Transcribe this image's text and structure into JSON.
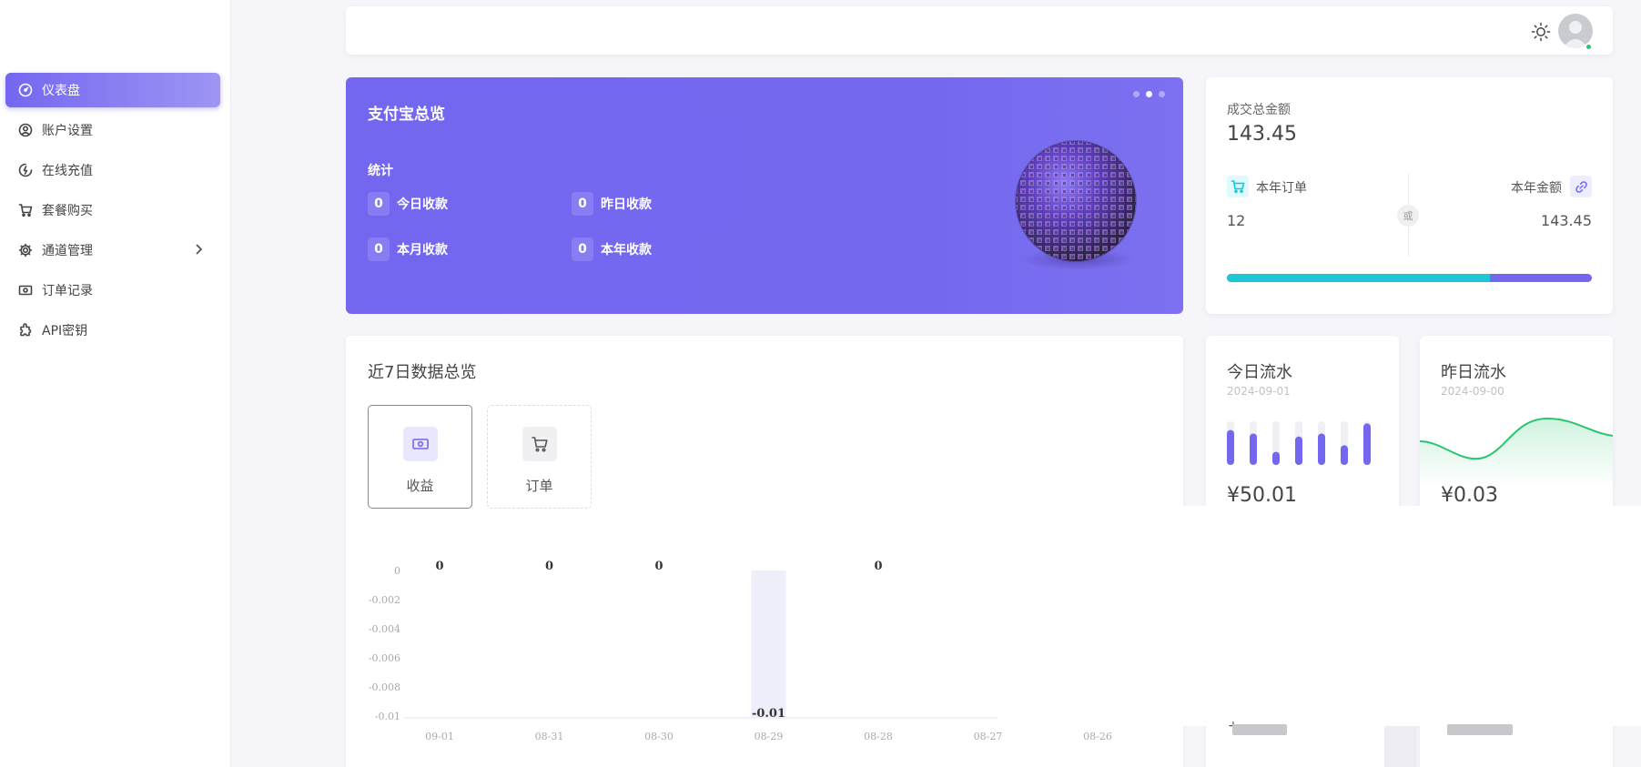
{
  "sidebar": {
    "items": [
      {
        "label": "仪表盘",
        "icon": "gauge-icon",
        "active": true
      },
      {
        "label": "账户设置",
        "icon": "user-circle-icon"
      },
      {
        "label": "在线充值",
        "icon": "recharge-icon"
      },
      {
        "label": "套餐购买",
        "icon": "cart-icon"
      },
      {
        "label": "通道管理",
        "icon": "gear-icon",
        "has_submenu": true
      },
      {
        "label": "订单记录",
        "icon": "banknote-icon"
      },
      {
        "label": "API密钥",
        "icon": "puzzle-icon"
      }
    ]
  },
  "header": {
    "theme_icon": "sun-icon",
    "avatar": "avatar",
    "online_status_color": "#28c76f"
  },
  "alipay_card": {
    "title": "支付宝总览",
    "section_label": "统计",
    "stats": [
      {
        "value": "0",
        "label": "今日收款"
      },
      {
        "value": "0",
        "label": "昨日收款"
      },
      {
        "value": "0",
        "label": "本月收款"
      },
      {
        "value": "0",
        "label": "本年收款"
      }
    ],
    "carousel_dots": 3,
    "carousel_active": 1,
    "background_color": "#7367f0"
  },
  "total_card": {
    "label": "成交总金额",
    "value": "143.45",
    "orders_label": "本年订单",
    "orders_value": "12",
    "amount_label": "本年金额",
    "amount_value": "143.45",
    "divider_text": "或",
    "progress_fraction": 0.72,
    "progress_colors": {
      "fill": "#1ec6d6",
      "track": "#7367f0"
    }
  },
  "week_card": {
    "title": "近7日数据总览",
    "tabs": [
      {
        "label": "收益",
        "icon": "banknote-icon",
        "active": true
      },
      {
        "label": "订单",
        "icon": "cart-icon",
        "active": false
      }
    ]
  },
  "chart_data": {
    "type": "bar",
    "categories": [
      "09-01",
      "08-31",
      "08-30",
      "08-29",
      "08-28",
      "08-27",
      "08-26"
    ],
    "values": [
      0,
      0,
      0,
      -0.01,
      0,
      null,
      null
    ],
    "data_labels": [
      "0",
      "0",
      "0",
      "-0.01",
      "0",
      "",
      ""
    ],
    "y_ticks": [
      "0",
      "-0.002",
      "-0.004",
      "-0.006",
      "-0.008",
      "-0.01"
    ],
    "ylim": [
      -0.01,
      0
    ],
    "bar_color": "#efeefb",
    "grid": false
  },
  "today_card": {
    "title": "今日流水",
    "date": "2024-09-01",
    "amount": "¥50.01",
    "mini_bars": [
      0.8,
      0.72,
      0.3,
      0.65,
      0.72,
      0.45,
      0.95
    ],
    "bar_color": "#7367f0"
  },
  "yesterday_card": {
    "title": "昨日流水",
    "date": "2024-09-00",
    "amount": "¥0.03",
    "line_color": "#28c76f"
  },
  "footer_fragment": {
    "plus": "+"
  }
}
